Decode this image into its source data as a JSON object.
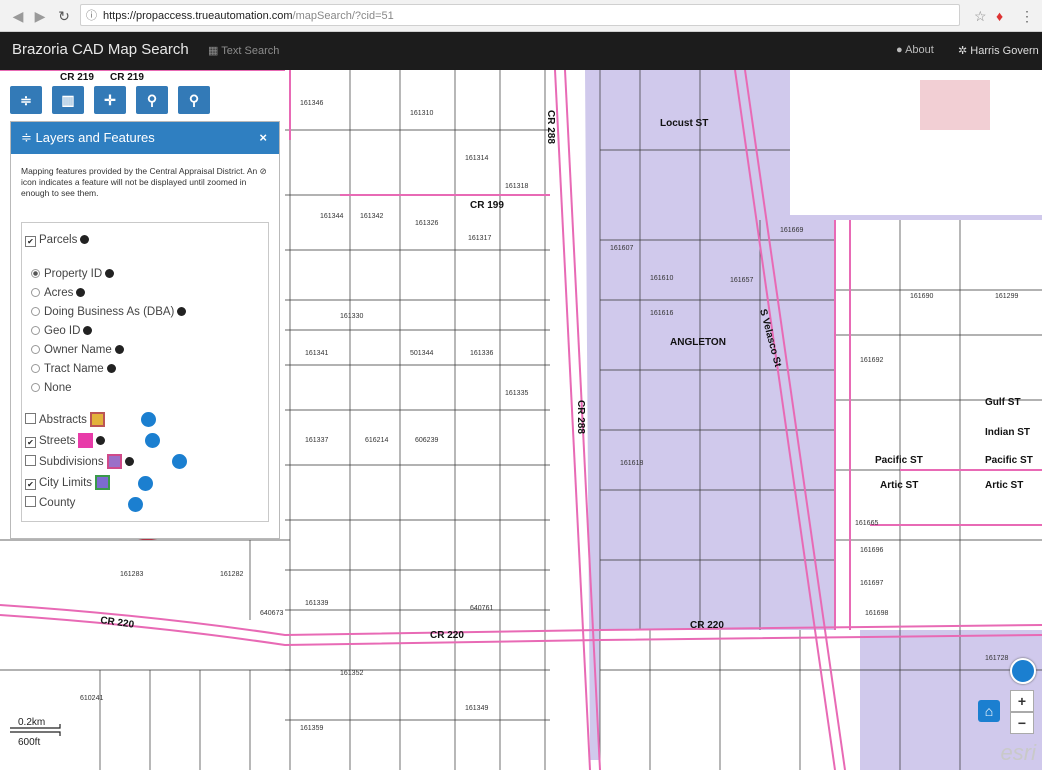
{
  "browser": {
    "url_host": "https://propaccess.trueautomation.com",
    "url_path": "/mapSearch/?cid=51"
  },
  "header": {
    "title": "Brazoria CAD Map Search",
    "text_search": "Text Search",
    "about": "About",
    "government": "Harris Govern"
  },
  "panel": {
    "title": "Layers and Features",
    "close": "×",
    "description": "Mapping features provided by the Central Appraisal District. An ⊘ icon indicates a feature will not be displayed until zoomed in enough to see them.",
    "parcels": "Parcels",
    "label_options": [
      "Property ID",
      "Acres",
      "Doing Business As (DBA)",
      "Geo ID",
      "Owner Name",
      "Tract Name",
      "None"
    ],
    "layers": [
      {
        "label": "Abstracts",
        "checked": false,
        "color": "#e3b23c"
      },
      {
        "label": "Streets",
        "checked": true,
        "color": "#e83ba9"
      },
      {
        "label": "Subdivisions",
        "checked": false,
        "color": "#9b6fc8"
      },
      {
        "label": "City Limits",
        "checked": true,
        "color": "#7c6bd0"
      },
      {
        "label": "County",
        "checked": false,
        "color": ""
      }
    ]
  },
  "map": {
    "scale_km": "0.2km",
    "scale_ft": "600ft",
    "streets": {
      "cr219": "CR 219",
      "cr199": "CR 199",
      "cr220": "CR 220",
      "cr288": "CR 288",
      "locust": "Locust ST",
      "velasco": "S Velasco St",
      "gulf": "Gulf ST",
      "indian": "Indian ST",
      "pacific": "Pacific ST",
      "artic": "Artic ST",
      "angleton": "ANGLETON",
      "ch": "CR 220"
    },
    "parcels": [
      "161346",
      "161310",
      "161314",
      "161318",
      "161344",
      "161342",
      "161326",
      "161317",
      "161330",
      "161341",
      "501344",
      "161336",
      "161337",
      "616214",
      "606239",
      "161335",
      "161282",
      "161283",
      "640673",
      "161339",
      "640761",
      "161352",
      "161349",
      "610241",
      "161359",
      "161607",
      "161610",
      "161616",
      "161618",
      "161657",
      "161669",
      "161692",
      "161690",
      "161299",
      "161665",
      "161696",
      "161697",
      "161698",
      "161728"
    ]
  },
  "controls": {
    "zoom_in": "+",
    "zoom_out": "−",
    "brand": "esri"
  },
  "colors": {
    "city_limits": "#c9c3e9",
    "streets": "#e86ab5",
    "panel_header": "#2f7fc1",
    "annotation": "#e8102c"
  }
}
